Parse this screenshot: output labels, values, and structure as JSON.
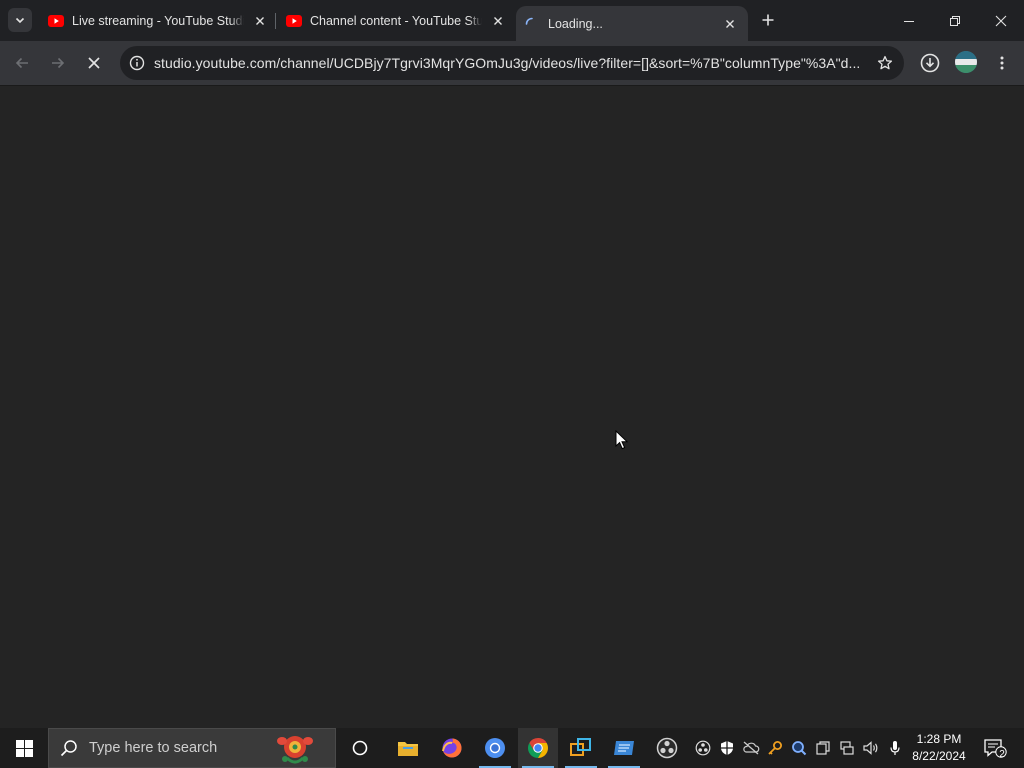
{
  "browser": {
    "tabs": [
      {
        "title": "Live streaming - YouTube Studio",
        "favicon": "youtube-icon"
      },
      {
        "title": "Channel content - YouTube Studio",
        "favicon": "youtube-icon"
      },
      {
        "title": "Loading...",
        "favicon": "loading-spinner-icon",
        "active": true
      }
    ],
    "address_bar": {
      "url": "studio.youtube.com/channel/UCDBjy7Tgrvi3MqrYGOmJu3g/videos/live?filter=[]&sort=%7B\"columnType\"%3A\"d..."
    }
  },
  "taskbar": {
    "search_placeholder": "Type here to search",
    "time": "1:28 PM",
    "date": "8/22/2024",
    "notification_count": "2"
  },
  "colors": {
    "page_bg": "#242424",
    "tabstrip_bg": "#202124",
    "toolbar_bg": "#35363a",
    "youtube_red": "#ff0000",
    "taskbar_bg": "#1d1d1d"
  }
}
